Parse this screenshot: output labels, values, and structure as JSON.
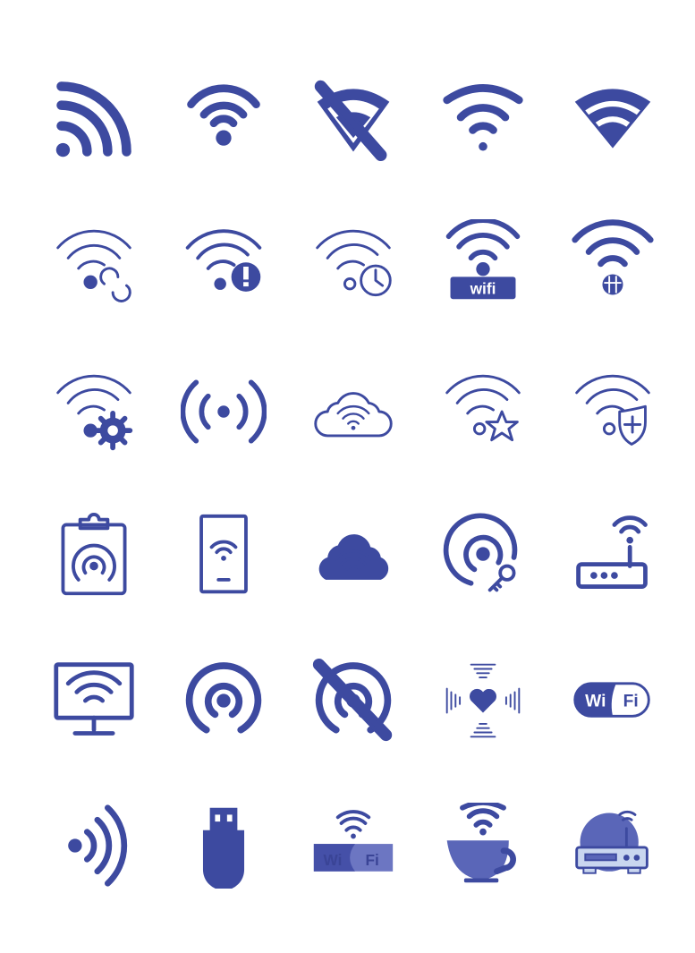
{
  "title": "",
  "colors": {
    "primary": "#3d4aa0",
    "light": "#5a66b8",
    "pale": "#c9d6ef"
  },
  "icons": [
    {
      "name": "rss-signal"
    },
    {
      "name": "wifi"
    },
    {
      "name": "wifi-off"
    },
    {
      "name": "wifi-bold"
    },
    {
      "name": "wifi-filled"
    },
    {
      "name": "wifi-sync"
    },
    {
      "name": "wifi-alert"
    },
    {
      "name": "wifi-clock"
    },
    {
      "name": "wifi-label",
      "text": "wifi"
    },
    {
      "name": "wifi-globe"
    },
    {
      "name": "wifi-settings"
    },
    {
      "name": "broadcast"
    },
    {
      "name": "cloud-wifi-outline"
    },
    {
      "name": "wifi-star"
    },
    {
      "name": "wifi-shield-plus"
    },
    {
      "name": "clipboard-hotspot"
    },
    {
      "name": "phone-wifi"
    },
    {
      "name": "cloud-wifi-filled"
    },
    {
      "name": "hotspot-key"
    },
    {
      "name": "router"
    },
    {
      "name": "monitor-wifi"
    },
    {
      "name": "hotspot"
    },
    {
      "name": "hotspot-off"
    },
    {
      "name": "heart-signal"
    },
    {
      "name": "wifi-badge",
      "text_left": "Wi",
      "text_right": "Fi"
    },
    {
      "name": "wifi-side"
    },
    {
      "name": "usb-dongle"
    },
    {
      "name": "wifi-sign",
      "text_left": "Wi",
      "text_right": "Fi"
    },
    {
      "name": "coffee-wifi"
    },
    {
      "name": "router-circle"
    }
  ]
}
